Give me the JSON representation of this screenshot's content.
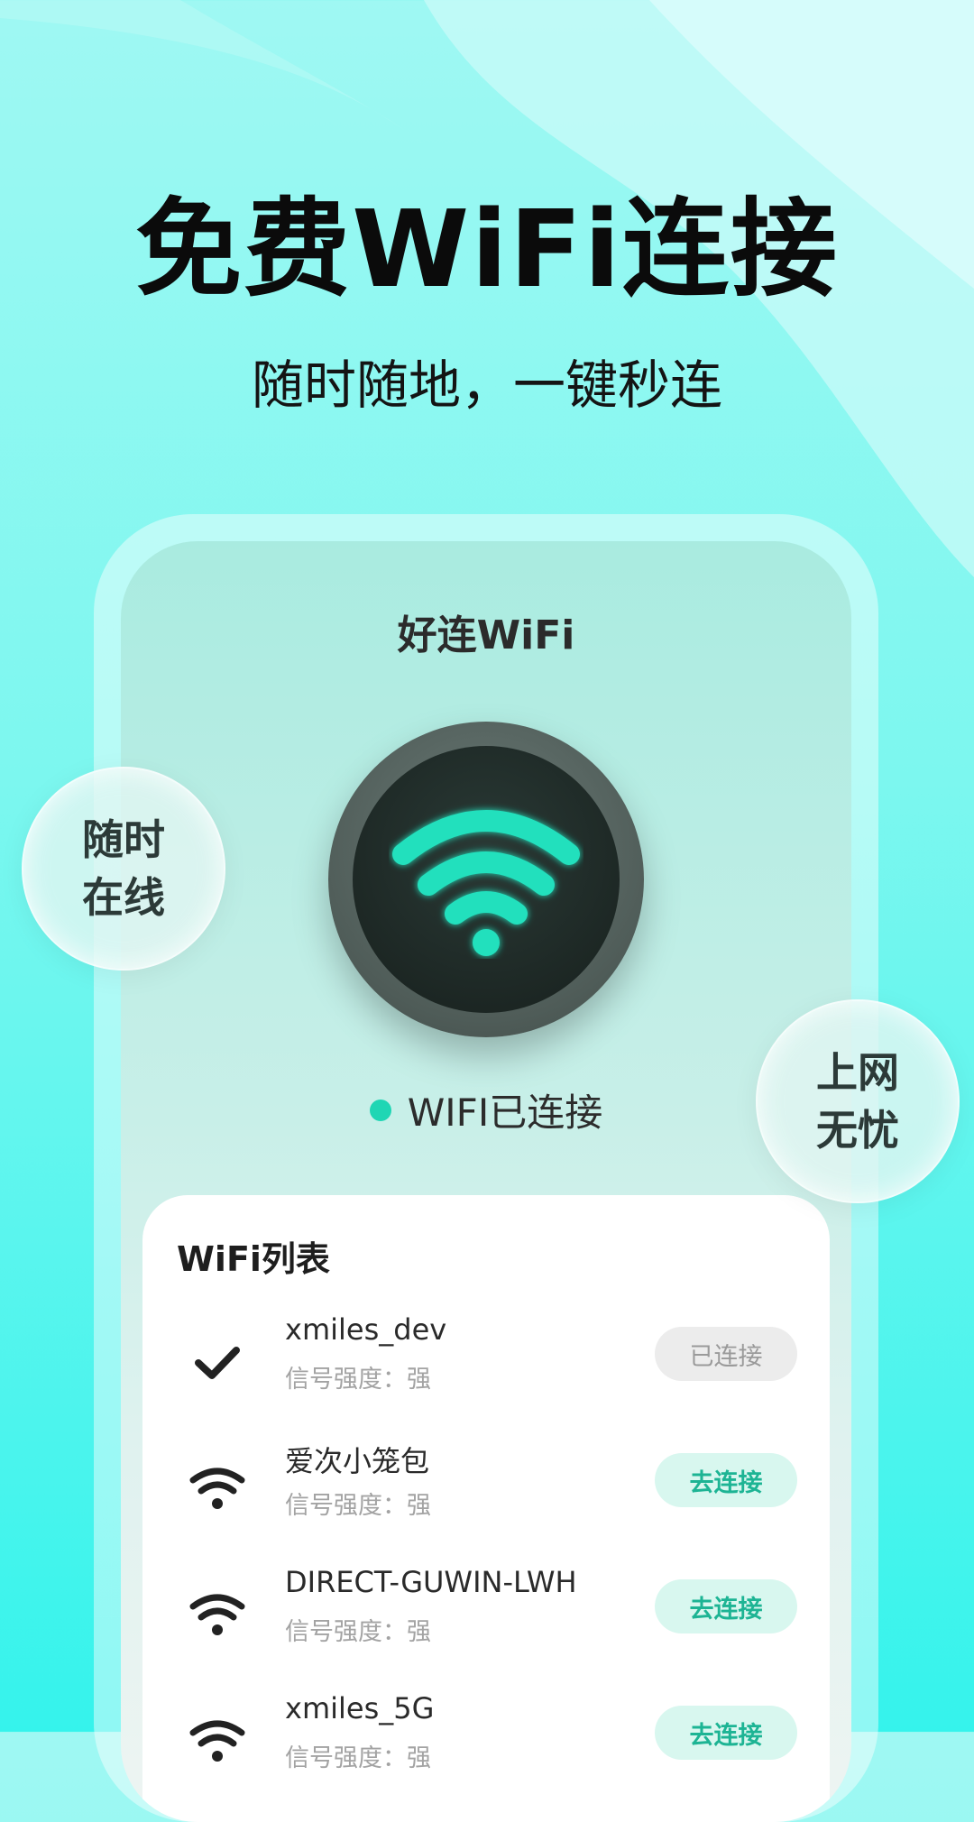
{
  "hero": {
    "title": "免费WiFi连接",
    "subtitle": "随时随地，一键秒连"
  },
  "app": {
    "title": "好连WiFi",
    "status": "WIFI已连接"
  },
  "bubbles": {
    "left": {
      "line1": "随时",
      "line2": "在线"
    },
    "right": {
      "line1": "上网",
      "line2": "无忧"
    }
  },
  "wifi_list": {
    "title": "WiFi列表",
    "items": [
      {
        "name": "xmiles_dev",
        "signal": "信号强度：强",
        "button": "已连接",
        "icon": "check-icon",
        "connected": true
      },
      {
        "name": "爱次小笼包",
        "signal": "信号强度：强",
        "button": "去连接",
        "icon": "wifi-icon",
        "connected": false
      },
      {
        "name": "DIRECT-GUWIN-LWH",
        "signal": "信号强度：强",
        "button": "去连接",
        "icon": "wifi-icon",
        "connected": false
      },
      {
        "name": "xmiles_5G",
        "signal": "信号强度：强",
        "button": "去连接",
        "icon": "wifi-icon",
        "connected": false
      }
    ]
  },
  "colors": {
    "accent": "#1fd6b4",
    "accent_button_bg": "#d8f7ef",
    "accent_button_text": "#1db494",
    "background_top": "#9ff8f3",
    "background_bottom": "#35f3ec"
  }
}
